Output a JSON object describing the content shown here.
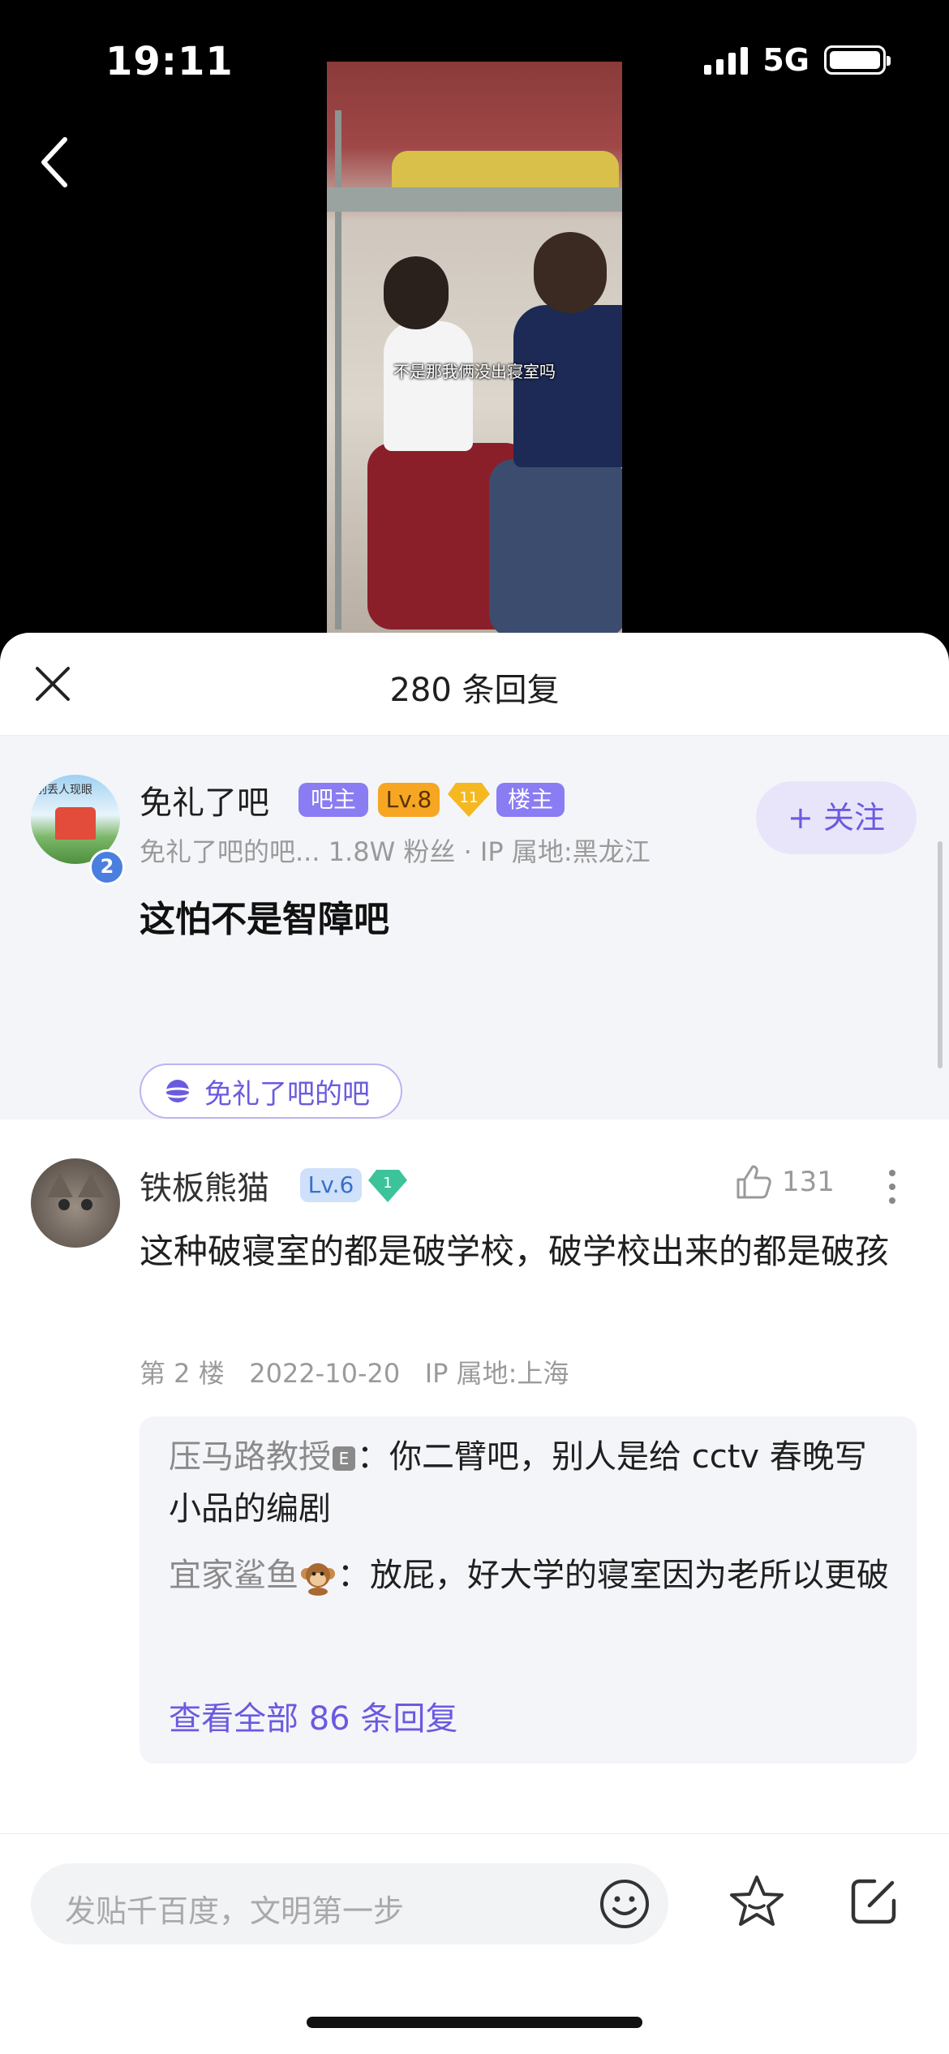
{
  "status_bar": {
    "time": "19:11",
    "network": "5G"
  },
  "video": {
    "subtitle": "不是那我俩没出寝室吗"
  },
  "sheet": {
    "title": "280 条回复"
  },
  "original_post": {
    "avatar_text": "别丢人现眼",
    "avatar_badge": "2",
    "username": "免礼了吧",
    "tags": {
      "admin": "吧主",
      "level": "Lv.8",
      "diamond": "11",
      "owner": "楼主"
    },
    "subline": "免礼了吧的吧...   1.8W 粉丝 · IP 属地:黑龙江",
    "follow_label": "+ 关注",
    "content": "这怕不是智障吧",
    "forum_chip": "免礼了吧的吧"
  },
  "reply": {
    "username": "铁板熊猫",
    "level": "Lv.6",
    "diamond": "1",
    "like_count": "131",
    "content": "这种破寝室的都是破学校，破学校出来的都是破孩",
    "floor": "第 2 楼",
    "date": "2022-10-20",
    "ip": "IP 属地:上海",
    "sub_replies": [
      {
        "author": "压马路教授",
        "badge": "E",
        "text": "：你二臂吧，别人是给 cctv 春晚写小品的编剧"
      },
      {
        "author": "宜家鲨鱼",
        "text": "：放屁，好大学的寝室因为老所以更破"
      }
    ],
    "view_all": "查看全部 86 条回复"
  },
  "composer": {
    "placeholder": "发贴千百度，文明第一步"
  },
  "colors": {
    "accent": "#6a5ae0",
    "level_orange": "#f6a623",
    "level_blue": "#cfe0fb"
  }
}
